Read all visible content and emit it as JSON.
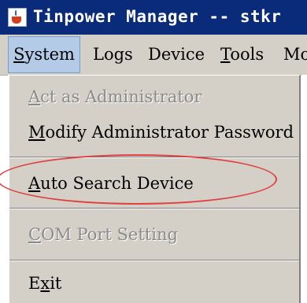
{
  "window": {
    "title": "Tinpower Manager -- stkr",
    "icon": "java-cup-icon"
  },
  "menubar": {
    "items": [
      {
        "label": "System",
        "mnemonic": "S",
        "rest": "ystem",
        "active": true
      },
      {
        "label": "Logs"
      },
      {
        "label": "Device"
      },
      {
        "label": "Tools",
        "mnemonic": "T",
        "rest": "ools"
      },
      {
        "label": "Mo"
      }
    ]
  },
  "system_menu": {
    "items": [
      {
        "label": "Act as Administrator",
        "pre": "",
        "mnemonic": "A",
        "post": "ct as Administrator",
        "enabled": false
      },
      {
        "label": "Modify Administrator Password",
        "pre": "",
        "mnemonic": "M",
        "post": "odify Administrator Password",
        "enabled": true
      },
      {
        "label": "Auto Search Device",
        "pre": "",
        "mnemonic": "A",
        "post": "uto Search Device",
        "enabled": true,
        "highlighted": true
      },
      {
        "label": "COM Port Setting",
        "pre": "",
        "mnemonic": "C",
        "post": "OM Port Setting",
        "enabled": false
      },
      {
        "label": "Exit",
        "pre": "E",
        "mnemonic": "x",
        "post": "it",
        "enabled": true
      }
    ]
  },
  "colors": {
    "titlebar": "#0a2a7a",
    "menu_bg": "#d4d0c8",
    "highlight_ring": "#e04040"
  }
}
